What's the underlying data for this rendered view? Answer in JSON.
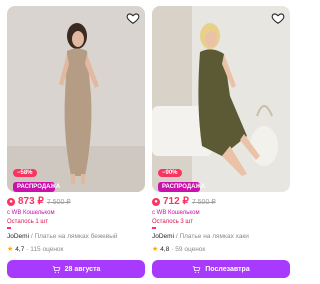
{
  "cards": [
    {
      "discount": "−58%",
      "sale_label": "РАСПРОДАЖА",
      "price": "873 ₽",
      "old_price": "7 500 ₽",
      "wallet": "с WB Кошельком",
      "stock": "Осталось 1 шт",
      "brand": "JoDemi",
      "separator": " / ",
      "name": "Платье на лямках бежевый",
      "rating": "4,7",
      "reviews": "· 115 оценок",
      "button": "28 августа"
    },
    {
      "discount": "−90%",
      "sale_label": "РАСПРОДАЖА",
      "price": "712 ₽",
      "old_price": "7 500 ₽",
      "wallet": "с WB Кошельком",
      "stock": "Осталось 3 шт",
      "brand": "JoDemi",
      "separator": " / ",
      "name": "Платье на лямках хаки",
      "rating": "4,8",
      "reviews": "· 59 оценок",
      "button": "Послезавтра"
    }
  ],
  "colors": {
    "accent": "#a73afd",
    "price": "#f93460",
    "sale": "#cb11ab"
  },
  "icons": {
    "favorite": "heart-icon",
    "cart": "cart-icon",
    "wb": "wb-logo-icon",
    "rating": "star-icon"
  }
}
